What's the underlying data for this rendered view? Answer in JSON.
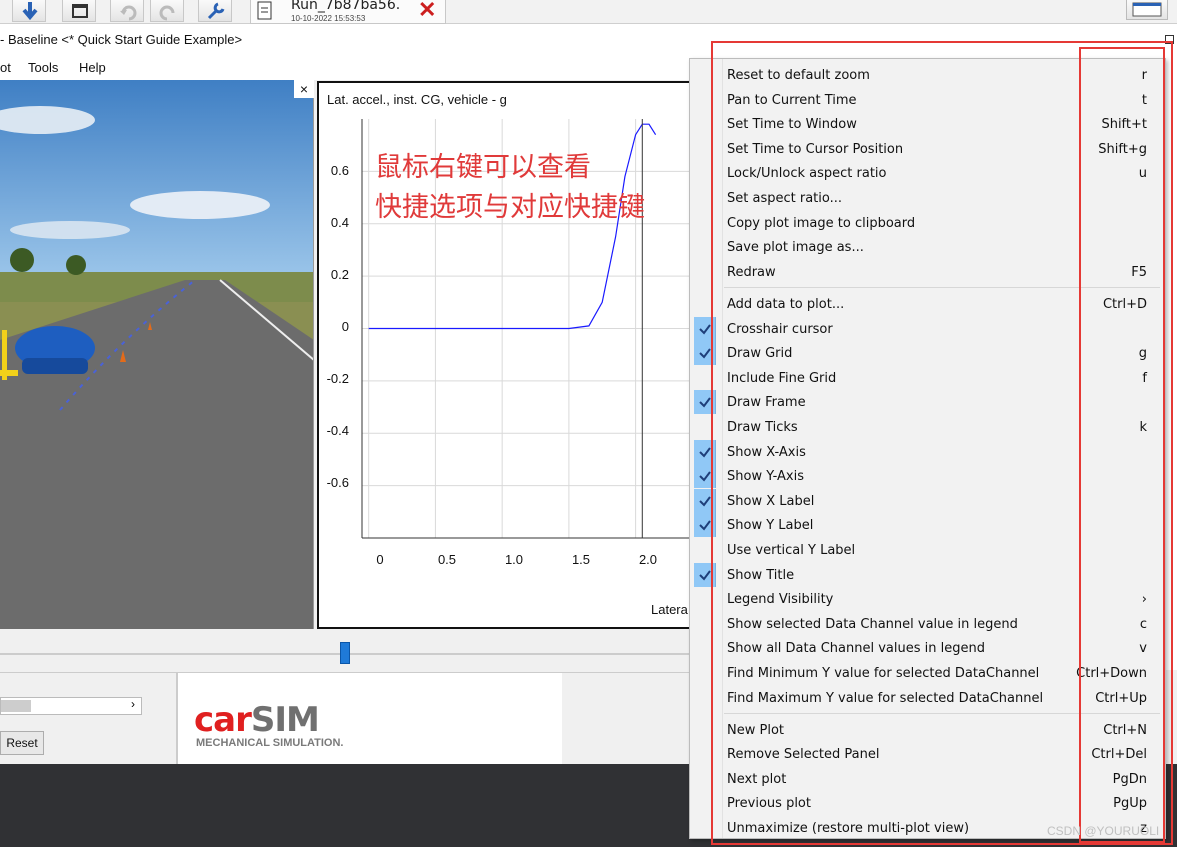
{
  "toolbar": {
    "run_name": "Run_7b87ba56.",
    "run_date": "10-10-2022 15:53:53"
  },
  "window": {
    "title": "- Baseline <* Quick Start Guide Example>"
  },
  "menubar": {
    "items": [
      "ot",
      "Tools",
      "Help"
    ]
  },
  "viewport": {
    "close_label": "×"
  },
  "plot": {
    "title": "Lat. accel., inst. CG, vehicle - g",
    "y_ticks": [
      "0.6",
      "0.4",
      "0.2",
      "0",
      "-0.2",
      "-0.4",
      "-0.6"
    ],
    "x_ticks": [
      "0",
      "0.5",
      "1.0",
      "1.5",
      "2.0"
    ],
    "x_label": "Latera",
    "annotation_line1": "鼠标右键可以查看",
    "annotation_line2": "快捷选项与对应快捷键",
    "annotation_color": "#e03a3a",
    "line_color": "#1a1aff"
  },
  "chart_data": {
    "type": "line",
    "title": "Lat. accel., inst. CG, vehicle - g",
    "xlabel": "Latera",
    "ylabel": "",
    "xlim": [
      -0.05,
      2.4
    ],
    "ylim": [
      -0.8,
      0.8
    ],
    "grid": true,
    "series": [
      {
        "x": [
          0,
          0.5,
          1.0,
          1.5,
          1.65,
          1.75,
          1.85,
          1.92,
          2.0,
          2.05,
          2.1,
          2.15
        ],
        "y": [
          0,
          0,
          0,
          0,
          0.01,
          0.1,
          0.35,
          0.58,
          0.74,
          0.78,
          0.78,
          0.74
        ]
      }
    ]
  },
  "bottom": {
    "reset_label": "Reset",
    "logo_car": "car",
    "logo_sim": "SIM",
    "logo_sub": "MECHANICAL SIMULATION."
  },
  "context_menu": {
    "items": [
      {
        "label": "Reset to default zoom",
        "shortcut": "r",
        "checked": false
      },
      {
        "label": "Pan to Current Time",
        "shortcut": "t",
        "checked": false
      },
      {
        "label": "Set Time to Window",
        "shortcut": "Shift+t",
        "checked": false
      },
      {
        "label": "Set Time to Cursor Position",
        "shortcut": "Shift+g",
        "checked": false
      },
      {
        "label": "Lock/Unlock aspect ratio",
        "shortcut": "u",
        "checked": false
      },
      {
        "label": "Set aspect ratio...",
        "shortcut": "",
        "checked": false
      },
      {
        "label": "Copy plot image to clipboard",
        "shortcut": "",
        "checked": false
      },
      {
        "label": "Save plot image as...",
        "shortcut": "",
        "checked": false
      },
      {
        "label": "Redraw",
        "shortcut": "F5",
        "checked": false
      },
      {
        "label": "Add data to plot...",
        "shortcut": "Ctrl+D",
        "checked": false
      },
      {
        "label": "Crosshair cursor",
        "shortcut": "",
        "checked": true
      },
      {
        "label": "Draw Grid",
        "shortcut": "g",
        "checked": true
      },
      {
        "label": "Include Fine Grid",
        "shortcut": "f",
        "checked": false
      },
      {
        "label": "Draw Frame",
        "shortcut": "",
        "checked": true
      },
      {
        "label": "Draw Ticks",
        "shortcut": "k",
        "checked": false
      },
      {
        "label": "Show X-Axis",
        "shortcut": "",
        "checked": true
      },
      {
        "label": "Show Y-Axis",
        "shortcut": "",
        "checked": true
      },
      {
        "label": "Show X Label",
        "shortcut": "",
        "checked": true
      },
      {
        "label": "Show Y Label",
        "shortcut": "",
        "checked": true
      },
      {
        "label": "Use vertical Y Label",
        "shortcut": "",
        "checked": false
      },
      {
        "label": "Show Title",
        "shortcut": "",
        "checked": true
      },
      {
        "label": "Legend Visibility",
        "shortcut": "›",
        "checked": false
      },
      {
        "label": "Show selected Data Channel value in legend",
        "shortcut": "c",
        "checked": false
      },
      {
        "label": "Show all Data Channel values in legend",
        "shortcut": "v",
        "checked": false
      },
      {
        "label": "Find Minimum Y value for selected DataChannel",
        "shortcut": "Ctrl+Down",
        "checked": false
      },
      {
        "label": "Find Maximum Y value for selected DataChannel",
        "shortcut": "Ctrl+Up",
        "checked": false
      },
      {
        "label": "New Plot",
        "shortcut": "Ctrl+N",
        "checked": false
      },
      {
        "label": "Remove Selected Panel",
        "shortcut": "Ctrl+Del",
        "checked": false
      },
      {
        "label": "Next plot",
        "shortcut": "PgDn",
        "checked": false
      },
      {
        "label": "Previous plot",
        "shortcut": "PgUp",
        "checked": false
      },
      {
        "label": "Unmaximize (restore multi-plot view)",
        "shortcut": "z",
        "checked": false
      }
    ]
  },
  "watermark": "CSDN @YOURUOLI"
}
